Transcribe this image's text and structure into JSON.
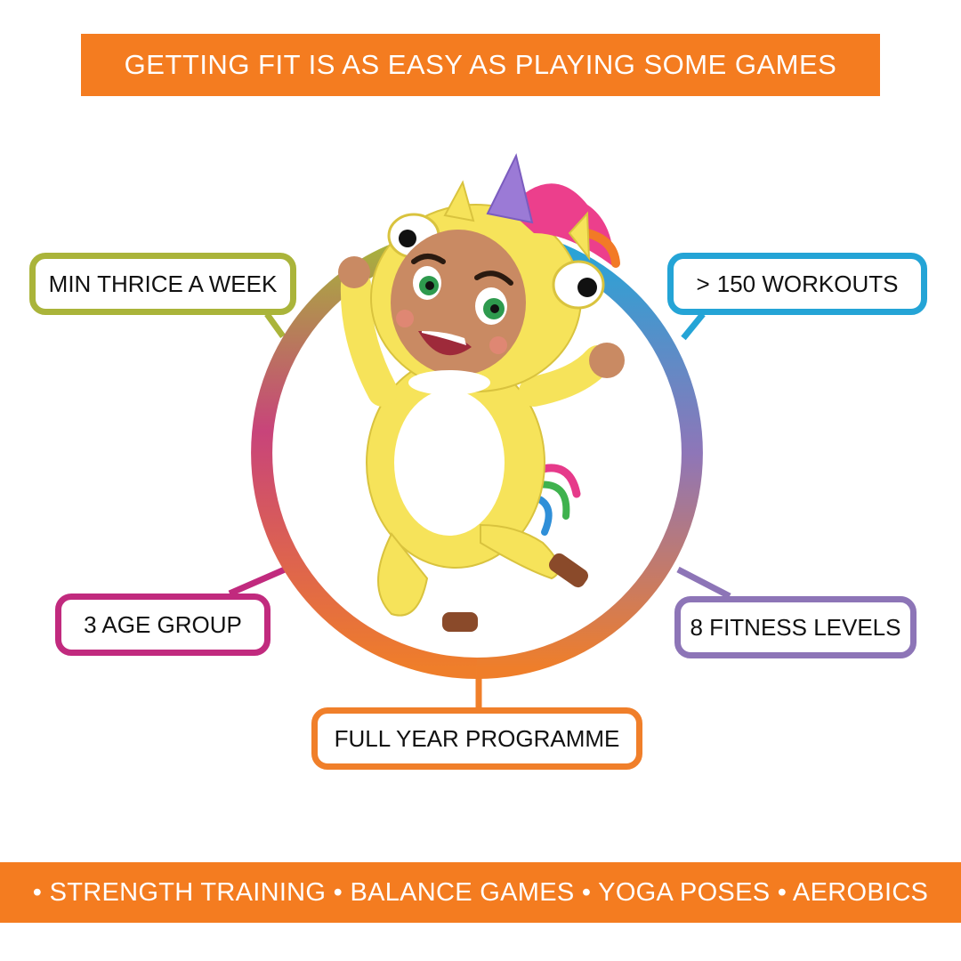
{
  "header": {
    "title": "GETTING FIT IS AS EASY AS PLAYING SOME GAMES"
  },
  "features": {
    "frequency": "MIN THRICE A WEEK",
    "workouts_symbol": ">",
    "workouts": "150 WORKOUTS",
    "age_groups": "3 AGE GROUP",
    "fitness_levels": "8 FITNESS LEVELS",
    "programme": "FULL YEAR PROGRAMME"
  },
  "footer": {
    "activities": "• STRENGTH TRAINING • BALANCE GAMES • YOGA POSES • AEROBICS"
  },
  "colors": {
    "brand_orange": "#f47c20",
    "olive": "#aab43a",
    "cyan": "#24a4d6",
    "magenta": "#c12a7e",
    "purple": "#8d75b7",
    "orange": "#f07f2a"
  },
  "illustration": {
    "subject": "unicorn-costume-child-mascot"
  }
}
